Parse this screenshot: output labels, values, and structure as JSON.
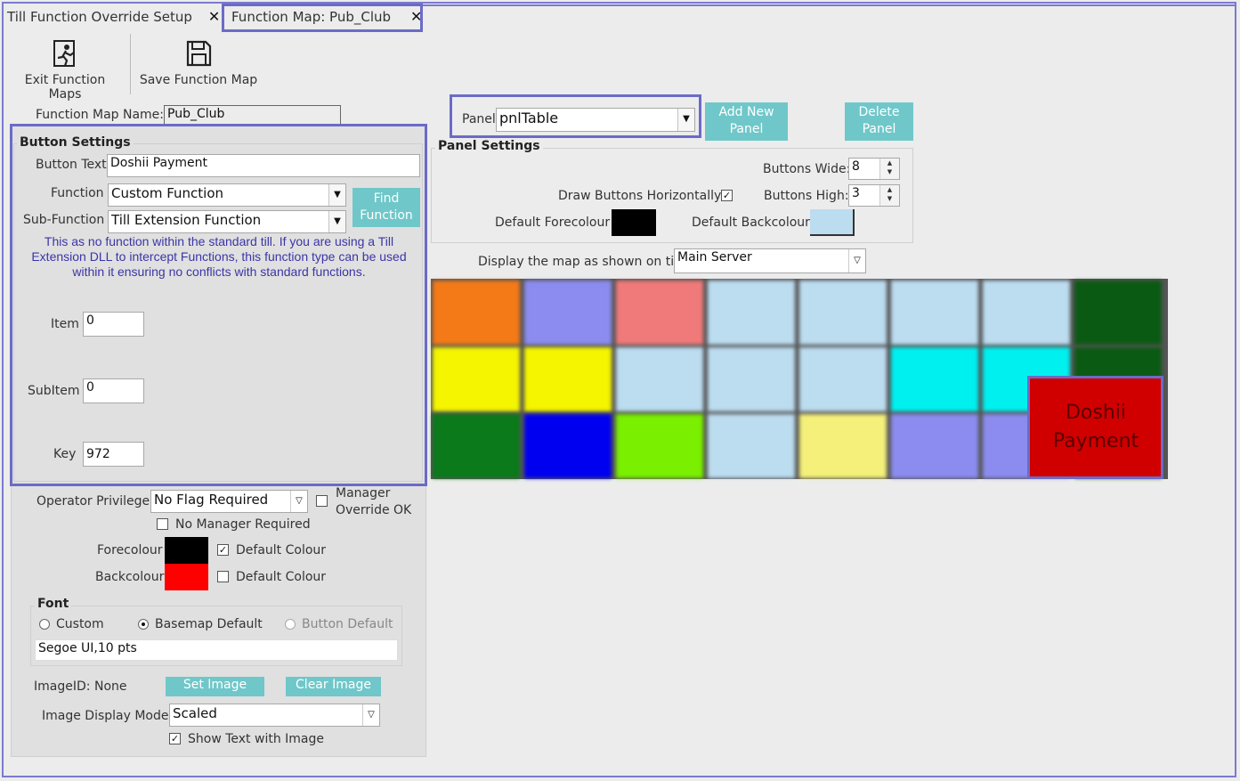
{
  "tabs": [
    {
      "label": "Till Function Override Setup",
      "close": "✕"
    },
    {
      "label": "Function Map: Pub_Club",
      "close": "✕"
    }
  ],
  "toolbar": {
    "exit_label": "Exit Function Maps",
    "save_label": "Save Function Map"
  },
  "function_map_name": {
    "label": "Function Map Name:",
    "value": "Pub_Club"
  },
  "button_settings": {
    "title": "Button Settings",
    "button_text_label": "Button Text",
    "button_text_value": "Doshii Payment",
    "function_label": "Function",
    "function_value": "Custom Function",
    "subfunction_label": "Sub-Function",
    "subfunction_value": "Till Extension Function",
    "find_function_label": "Find Function",
    "info_text": "This as no function within the standard till. If you are using a Till Extension DLL to intercept Functions, this function type can be used within it ensuring no conflicts with standard functions.",
    "item_label": "Item",
    "item_value": "0",
    "subitem_label": "SubItem",
    "subitem_value": "0",
    "key_label": "Key",
    "key_value": "972"
  },
  "operator": {
    "privilege_label": "Operator Privilege:",
    "privilege_value": "No Flag Required",
    "manager_override_label": "Manager Override OK",
    "manager_override_checked": false,
    "no_manager_label": "No Manager Required",
    "no_manager_checked": false
  },
  "colours": {
    "forecolour_label": "Forecolour",
    "forecolour": "#000000",
    "fore_default_label": "Default Colour",
    "fore_default_checked": true,
    "backcolour_label": "Backcolour",
    "backcolour": "#ff0000",
    "back_default_label": "Default Colour",
    "back_default_checked": false
  },
  "font": {
    "title": "Font",
    "custom_label": "Custom",
    "basemap_label": "Basemap Default",
    "button_default_label": "Button Default",
    "selected": "Basemap Default",
    "font_value": "Segoe UI,10 pts"
  },
  "image": {
    "id_label": "ImageID:",
    "id_value": "None",
    "set_label": "Set Image",
    "clear_label": "Clear Image",
    "display_mode_label": "Image Display Mode:",
    "display_mode_value": "Scaled",
    "show_text_label": "Show Text with Image",
    "show_text_checked": true
  },
  "panel": {
    "label": "Panel",
    "value": "pnlTable",
    "add_label": "Add New Panel",
    "delete_label": "Delete Panel"
  },
  "panel_settings": {
    "title": "Panel Settings",
    "buttons_wide_label": "Buttons Wide:",
    "buttons_wide_value": "8",
    "draw_horiz_label": "Draw Buttons Horizontally:",
    "draw_horiz_checked": true,
    "buttons_high_label": "Buttons High:",
    "buttons_high_value": "3",
    "default_fore_label": "Default Forecolour",
    "default_fore": "#000000",
    "default_back_label": "Default Backcolour",
    "default_back": "#bcdcf0"
  },
  "display_map": {
    "label": "Display the map as shown on till:",
    "value": "Main Server"
  },
  "selected_button": {
    "text": "Doshii Payment",
    "background": "#d00000"
  },
  "button_grid_colors": [
    "#f47a18",
    "#8c8cf0",
    "#f07a7a",
    "#bcdcf0",
    "#bcdcf0",
    "#bcdcf0",
    "#bcdcf0",
    "#0b5a14",
    "#f5f500",
    "#f5f500",
    "#bcdcf0",
    "#bcdcf0",
    "#bcdcf0",
    "#00f0f0",
    "#00f0f0",
    "#0b5a14",
    "#0a7a1a",
    "#0000f0",
    "#7af000",
    "#bcdcf0",
    "#f5f07a",
    "#8c8cf0",
    "#8c8cf0",
    "#0b5a14"
  ]
}
